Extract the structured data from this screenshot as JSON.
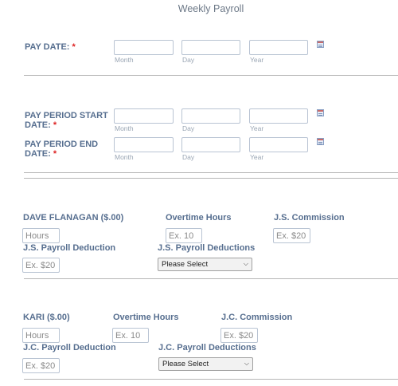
{
  "form_title": "Weekly Payroll",
  "date_parts": {
    "month": "Month",
    "day": "Day",
    "year": "Year"
  },
  "pay_date": {
    "label": "PAY DATE:",
    "required_mark": "*"
  },
  "period_start": {
    "label_line1": "PAY PERIOD START",
    "label_line2": "DATE:",
    "required_mark": "*"
  },
  "period_end": {
    "label_line1": "PAY PERIOD END",
    "label_line2": "DATE:",
    "required_mark": "*"
  },
  "icons": {
    "calendar": "calendar-icon",
    "select_arrow": "chevron-down-icon"
  },
  "employees": [
    {
      "name_label": "DAVE FLANAGAN ($.00)",
      "hours_placeholder": "Hours",
      "overtime_label": "Overtime Hours",
      "overtime_placeholder": "Ex. 10",
      "commission_label": "J.S. Commission",
      "commission_placeholder": "Ex. $20",
      "deduction_label": "J.S. Payroll Deduction",
      "deduction_placeholder": "Ex. $20",
      "deductions_label": "J.S. Payroll Deductions",
      "deductions_selected": "Please Select"
    },
    {
      "name_label": "KARI ($.00)",
      "hours_placeholder": "Hours",
      "overtime_label": "Overtime Hours",
      "overtime_placeholder": "Ex. 10",
      "commission_label": "J.C. Commission",
      "commission_placeholder": "Ex. $20",
      "deduction_label": "J.C. Payroll Deduction",
      "deduction_placeholder": "Ex. $20",
      "deductions_label": "J.C. Payroll Deductions",
      "deductions_selected": "Please Select"
    }
  ]
}
